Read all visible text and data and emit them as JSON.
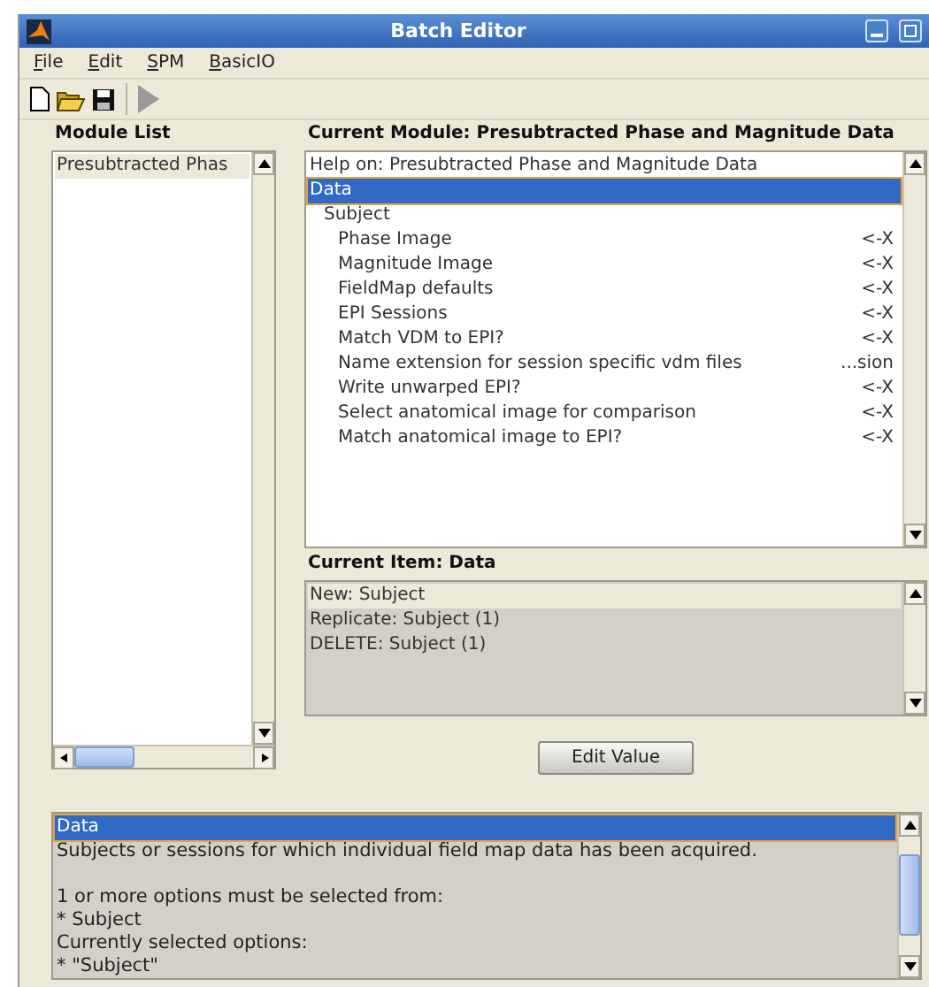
{
  "window": {
    "title": "Batch Editor"
  },
  "menu": [
    {
      "label": "File"
    },
    {
      "label": "Edit"
    },
    {
      "label": "SPM"
    },
    {
      "label": "BasicIO"
    }
  ],
  "toolbar": [
    {
      "kind": "new",
      "disabled": false
    },
    {
      "kind": "open",
      "disabled": false
    },
    {
      "kind": "save",
      "disabled": false
    },
    {
      "kind": "run",
      "disabled": true
    }
  ],
  "module_list": {
    "title": "Module List",
    "items": [
      {
        "label": "Presubtracted Phas",
        "selected": true
      }
    ]
  },
  "current_module": {
    "title": "Current Module: Presubtracted Phase and Magnitude Data",
    "items": [
      {
        "label": "Help on: Presubtracted Phase and Magnitude Data",
        "selected": false
      },
      {
        "label": "Data",
        "selected": true,
        "children": [
          {
            "label": "Subject",
            "selected": false,
            "children": [
              {
                "label": "Phase Image",
                "value": "<-X",
                "selected": false
              },
              {
                "label": "Magnitude Image",
                "value": "<-X",
                "selected": false
              },
              {
                "label": "FieldMap defaults",
                "value": "<-X",
                "selected": false
              },
              {
                "label": "EPI Sessions",
                "value": "<-X",
                "selected": false
              },
              {
                "label": "Match VDM to EPI?",
                "value": "<-X",
                "selected": false
              },
              {
                "label": "Name extension for session specific vdm files",
                "value": "...sion",
                "selected": false
              },
              {
                "label": "Write unwarped EPI?",
                "value": "<-X",
                "selected": false
              },
              {
                "label": "Select anatomical image for comparison",
                "value": "<-X",
                "selected": false
              },
              {
                "label": "Match anatomical image to EPI?",
                "value": "<-X",
                "selected": false
              }
            ]
          }
        ]
      }
    ]
  },
  "current_item": {
    "title": "Current Item: Data",
    "items": [
      {
        "label": "New: Subject",
        "selected": true
      },
      {
        "label": "Replicate: Subject (1)",
        "selected": false
      },
      {
        "label": "DELETE: Subject (1)",
        "selected": false
      }
    ]
  },
  "edit_button": {
    "label": "Edit Value"
  },
  "help": {
    "heading": {
      "label": "Data",
      "selected": true
    },
    "paragraphs": [
      [
        "Subjects or sessions for which individual field map data has been acquired."
      ],
      [
        "1 or more options must be selected from:",
        "* Subject",
        "Currently selected options:",
        "* \"Subject\""
      ]
    ]
  }
}
